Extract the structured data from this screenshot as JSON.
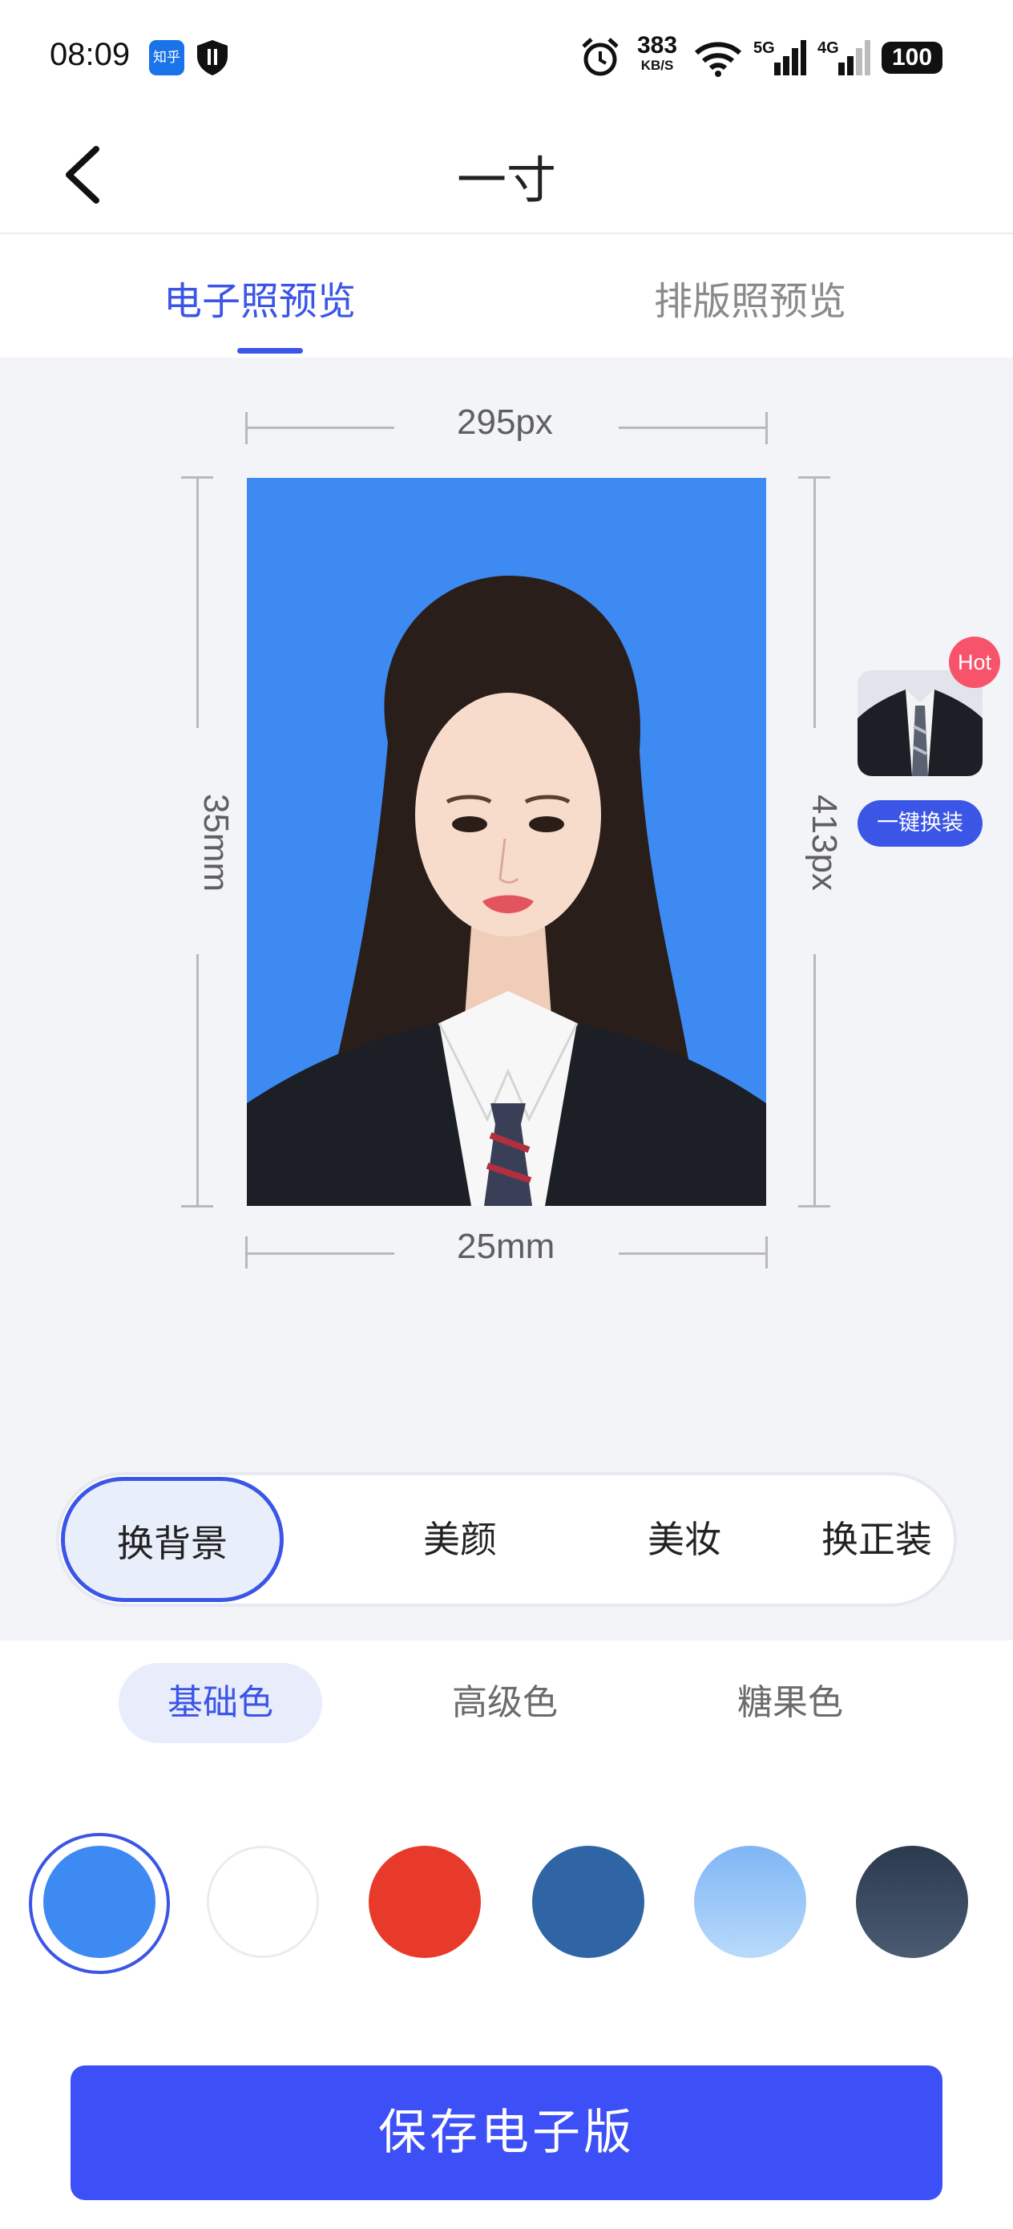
{
  "status_bar": {
    "time": "08:09",
    "zhihu_label": "知乎",
    "net_speed_value": "383",
    "net_speed_unit": "KB/S",
    "signal_1": "5G",
    "signal_2": "4G",
    "battery": "100"
  },
  "header": {
    "title": "一寸"
  },
  "tabs": [
    {
      "label": "电子照预览",
      "active": true
    },
    {
      "label": "排版照预览",
      "active": false
    }
  ],
  "preview": {
    "width_px_label": "295px",
    "height_px_label": "413px",
    "height_mm_label": "35mm",
    "width_mm_label": "25mm",
    "background_color": "#3d8bf2"
  },
  "suit_promo": {
    "badge": "Hot",
    "button_label": "一键换装"
  },
  "functions": [
    {
      "label": "换背景",
      "active": true
    },
    {
      "label": "美颜",
      "active": false
    },
    {
      "label": "美妆",
      "active": false
    },
    {
      "label": "换正装",
      "active": false
    }
  ],
  "color_categories": [
    {
      "label": "基础色",
      "active": true
    },
    {
      "label": "高级色",
      "active": false
    },
    {
      "label": "糖果色",
      "active": false
    }
  ],
  "swatches": [
    {
      "name": "blue",
      "color": "#3d8bf2",
      "selected": true
    },
    {
      "name": "white",
      "color": "#ffffff",
      "selected": false
    },
    {
      "name": "red",
      "color": "#e83a2a",
      "selected": false
    },
    {
      "name": "dark-blue",
      "color": "#2f64a5",
      "selected": false
    },
    {
      "name": "gradient-light-blue",
      "color": "#8ec1f6",
      "selected": false
    },
    {
      "name": "gradient-dark-gray",
      "color": "#3f5066",
      "selected": false
    }
  ],
  "accent_color": "#3b55e6",
  "save_button": {
    "label": "保存电子版"
  }
}
